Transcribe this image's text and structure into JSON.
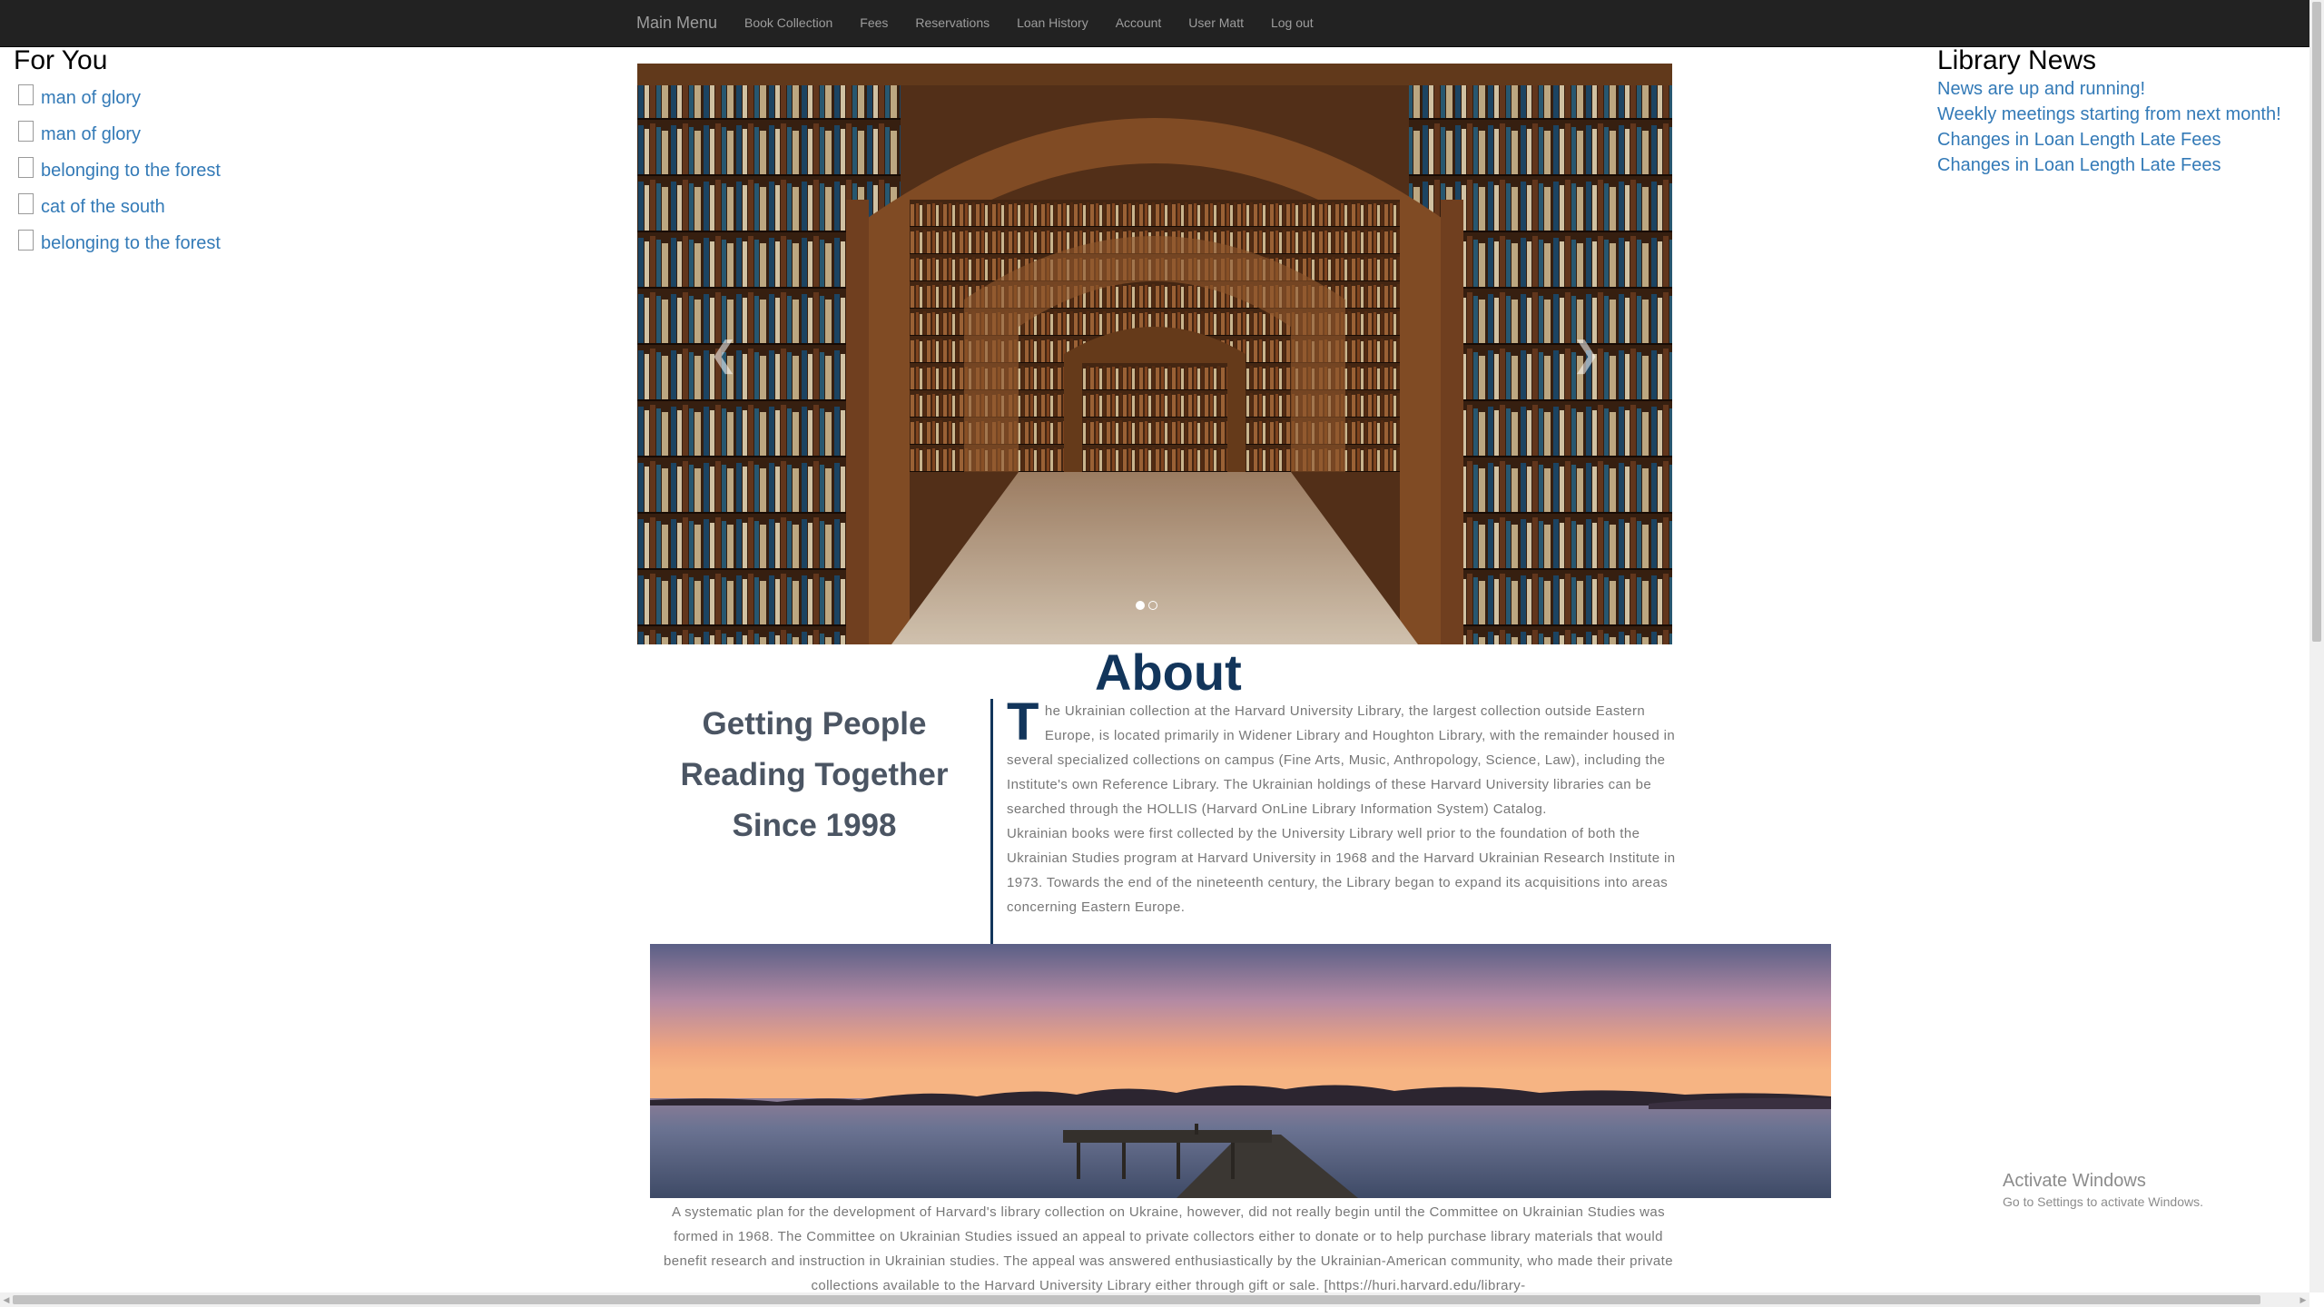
{
  "nav": {
    "brand": "Main Menu",
    "links": [
      "Book Collection",
      "Fees",
      "Reservations",
      "Loan History",
      "Account",
      "User Matt",
      "Log out"
    ]
  },
  "for_you": {
    "title": "For You",
    "items": [
      "man of glory",
      "man of glory",
      "belonging to the forest",
      "cat of the south",
      "belonging to the forest"
    ]
  },
  "news": {
    "title": "Library News",
    "items": [
      "News are up and running!",
      "Weekly meetings starting from next month!",
      "Changes in Loan Length Late Fees",
      "Changes in Loan Length Late Fees"
    ]
  },
  "carousel": {
    "prev_icon": "chevron-left-icon",
    "next_icon": "chevron-right-icon",
    "slide_count": 2,
    "active_slide": 1
  },
  "about": {
    "title": "About",
    "tagline_1": "Getting People",
    "tagline_2": "Reading Together",
    "tagline_3": "Since 1998",
    "dropcap": "T",
    "p1": "he Ukrainian collection at the Harvard University Library, the largest collection outside Eastern Europe, is located primarily in Widener Library and Houghton Library, with the remainder housed in several specialized collections on campus (Fine Arts, Music, Anthropology, Science, Law), including the Institute's own Reference Library. The Ukrainian holdings of these Harvard University libraries can be searched through the HOLLIS (Harvard OnLine Library Information System) Catalog.",
    "p2": "Ukrainian books were first collected by the University Library well prior to the foundation of both the Ukrainian Studies program at Harvard University in 1968 and the Harvard Ukrainian Research Institute in 1973. Towards the end of the nineteenth century, the Library began to expand its acquisitions into areas concerning Eastern Europe.",
    "p3": "A systematic plan for the development of Harvard's library collection on Ukraine, however, did not really begin until the Committee on Ukrainian Studies was formed in 1968. The Committee on Ukrainian Studies issued an appeal to private collectors either to donate or to help purchase library materials that would benefit research and instruction in Ukrainian studies. The appeal was answered enthusiastically by the Ukrainian-American community, who made their private collections available to the Harvard University Library either through gift or sale. [https://huri.harvard.edu/library-"
  },
  "watermark": {
    "line1": "Activate Windows",
    "line2": "Go to Settings to activate Windows."
  },
  "colors": {
    "navbar": "#222222",
    "nav_text": "#9d9d9d",
    "link": "#337ab7",
    "accent": "#12355b",
    "body_text": "#777777"
  }
}
